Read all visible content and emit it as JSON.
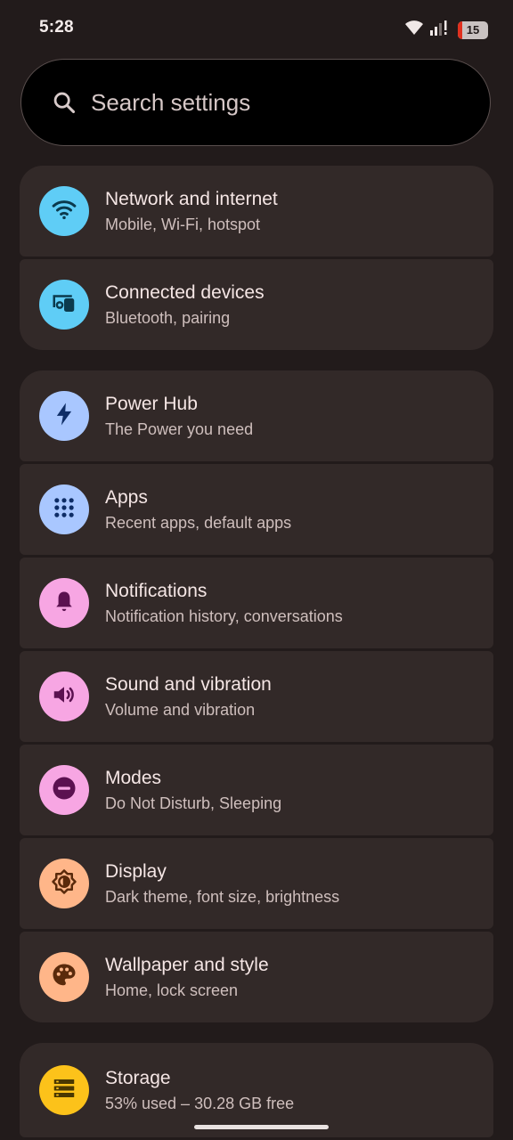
{
  "status_bar": {
    "time": "5:28",
    "battery_level": "15",
    "battery_fraction": 0.15,
    "icons": [
      "wifi-icon",
      "signal-icon",
      "battery-icon"
    ]
  },
  "search": {
    "placeholder": "Search settings",
    "icon": "search-icon"
  },
  "groups": [
    {
      "items": [
        {
          "title": "Network and internet",
          "subtitle": "Mobile, Wi-Fi, hotspot",
          "icon": "wifi-icon",
          "color": "#5fcdf6",
          "fg": "#0b3a4d"
        },
        {
          "title": "Connected devices",
          "subtitle": "Bluetooth, pairing",
          "icon": "devices-icon",
          "color": "#5fcdf6",
          "fg": "#0b3a4d"
        }
      ]
    },
    {
      "items": [
        {
          "title": "Power Hub",
          "subtitle": "The Power you need",
          "icon": "bolt-icon",
          "color": "#a9c7ff",
          "fg": "#0e2d66"
        },
        {
          "title": "Apps",
          "subtitle": "Recent apps, default apps",
          "icon": "apps-grid-icon",
          "color": "#a9c7ff",
          "fg": "#0e2d66"
        },
        {
          "title": "Notifications",
          "subtitle": "Notification history, conversations",
          "icon": "bell-icon",
          "color": "#f7a6e3",
          "fg": "#5b1150"
        },
        {
          "title": "Sound and vibration",
          "subtitle": "Volume and vibration",
          "icon": "speaker-icon",
          "color": "#f7a6e3",
          "fg": "#5b1150"
        },
        {
          "title": "Modes",
          "subtitle": "Do Not Disturb, Sleeping",
          "icon": "do-not-disturb-icon",
          "color": "#f7a6e3",
          "fg": "#5b1150"
        },
        {
          "title": "Display",
          "subtitle": "Dark theme, font size, brightness",
          "icon": "brightness-icon",
          "color": "#ffb689",
          "fg": "#5a2a0b"
        },
        {
          "title": "Wallpaper and style",
          "subtitle": "Home, lock screen",
          "icon": "palette-icon",
          "color": "#ffb689",
          "fg": "#5a2a0b"
        }
      ]
    },
    {
      "items": [
        {
          "title": "Storage",
          "subtitle": "53% used – 30.28 GB free",
          "icon": "storage-icon",
          "color": "#fcc21a",
          "fg": "#4a3800"
        }
      ]
    }
  ]
}
